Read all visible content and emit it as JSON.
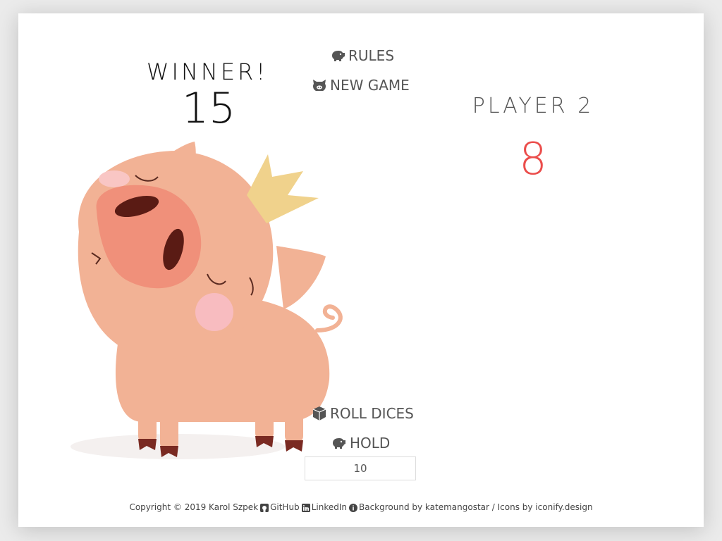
{
  "player1": {
    "status_label": "WINNER!",
    "score": "15"
  },
  "player2": {
    "name": "PLAYER 2",
    "score": "8"
  },
  "controls": {
    "rules_label": "RULES",
    "new_game_label": "NEW GAME",
    "roll_label": "ROLL DICES",
    "hold_label": "HOLD",
    "target_value": "10"
  },
  "icons": {
    "rules": "piggy-bank-icon",
    "new_game": "pig-face-icon",
    "roll": "dice-cube-icon",
    "hold": "piggy-bank-icon"
  },
  "footer": {
    "copyright": "Copyright © 2019 Karol Szpek",
    "github": "GitHub",
    "linkedin": "LinkedIn",
    "background_credit": "Background by katemangostar / Icons by iconify.design"
  },
  "colors": {
    "accent_score": "#eb4d4b",
    "text": "#555555",
    "pig": "#f2b295",
    "snout": "#f0907a",
    "crown": "#f0d28c"
  }
}
